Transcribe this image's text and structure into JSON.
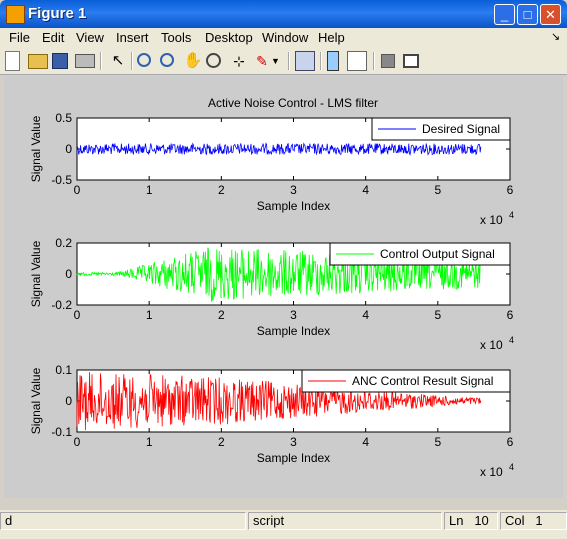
{
  "window": {
    "title": "Figure 1"
  },
  "menu": [
    "File",
    "Edit",
    "View",
    "Insert",
    "Tools",
    "Desktop",
    "Window",
    "Help"
  ],
  "figure": {
    "title": "Active Noise Control - LMS filter",
    "axes": [
      {
        "ylabel": "Signal Value",
        "xlabel": "Sample Index",
        "xexp": "x 10",
        "xexp_power": "4",
        "legend": "Desired Signal",
        "color": "#0000ff",
        "yticks": [
          "0.5",
          "0",
          "-0.5"
        ],
        "xticks": [
          "0",
          "1",
          "2",
          "3",
          "4",
          "5",
          "6"
        ]
      },
      {
        "ylabel": "Signal Value",
        "xlabel": "Sample Index",
        "xexp": "x 10",
        "xexp_power": "4",
        "legend": "Control Output Signal",
        "color": "#00ff00",
        "yticks": [
          "0.2",
          "0",
          "-0.2"
        ],
        "xticks": [
          "0",
          "1",
          "2",
          "3",
          "4",
          "5",
          "6"
        ]
      },
      {
        "ylabel": "Signal Value",
        "xlabel": "Sample Index",
        "xexp": "x 10",
        "xexp_power": "4",
        "legend": "ANC Control Result Signal",
        "color": "#ff0000",
        "yticks": [
          "0.1",
          "0",
          "-0.1"
        ],
        "xticks": [
          "0",
          "1",
          "2",
          "3",
          "4",
          "5",
          "6"
        ]
      }
    ]
  },
  "status": {
    "left": "d",
    "mode": "script",
    "ln_label": "Ln",
    "ln": "10",
    "col_label": "Col",
    "col": "1"
  }
}
